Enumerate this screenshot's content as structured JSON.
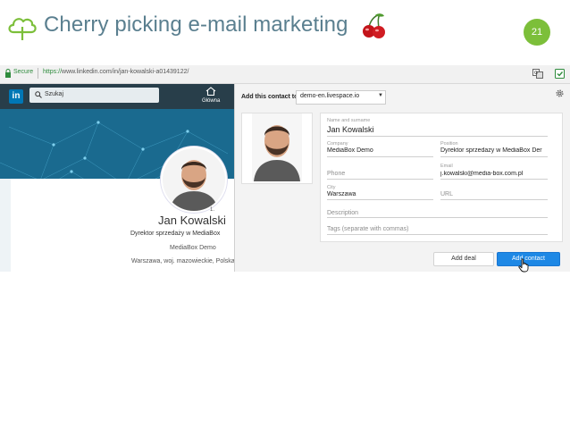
{
  "slide": {
    "title": "Cherry picking e-mail marketing",
    "page_number": "21",
    "icons": [
      "cloud-icon",
      "cherry-icon"
    ]
  },
  "browser": {
    "secure_label": "Secure",
    "url_scheme": "https://",
    "url_rest": "www.linkedin.com/in/jan-kowalski-a01439122/"
  },
  "linkedin": {
    "logo": "in",
    "search_placeholder": "Szukaj",
    "home_label": "Główna",
    "profile": {
      "degree": "1.",
      "name": "Jan Kowalski",
      "headline": "Dyrektor sprzedaży w MediaBox",
      "company": "MediaBox Demo",
      "location": "Warszawa, woj. mazowieckie, Polska"
    }
  },
  "panel": {
    "heading": "Add this contact to",
    "account": "demo-en.livespace.io",
    "fields": {
      "name_label": "Name and surname",
      "name_value": "Jan Kowalski",
      "company_label": "Company",
      "company_value": "MediaBox Demo",
      "position_label": "Position",
      "position_value": "Dyrektor sprzedaży w MediaBox Der",
      "phone_placeholder": "Phone",
      "email_label": "Email",
      "email_value": "j.kowalski@media-box.com.pl",
      "city_label": "City",
      "city_value": "Warszawa",
      "url_placeholder": "URL",
      "description_placeholder": "Description",
      "tags_placeholder": "Tags (separate with commas)"
    },
    "add_deal_label": "Add deal",
    "add_contact_label": "Add contact"
  },
  "colors": {
    "title_text": "#5a7f8f",
    "page_badge": "#7cbf3a",
    "linkedin_nav": "#283e4a",
    "linkedin_blue": "#0077b5",
    "primary_button": "#1e88e5"
  }
}
